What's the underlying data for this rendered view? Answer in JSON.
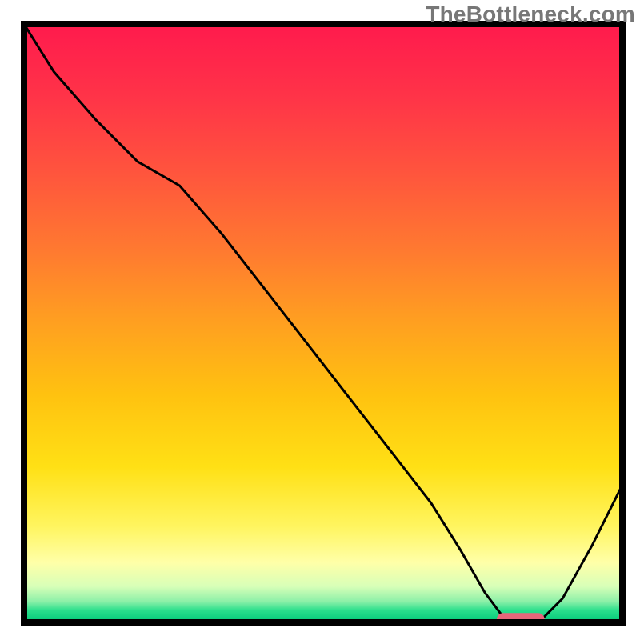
{
  "header": {
    "watermark": "TheBottleneck.com"
  },
  "colors": {
    "curve": "#000000",
    "marker": "#e6667a",
    "frame": "#000000",
    "gradient_stops": [
      "#ff1a4d",
      "#ff3348",
      "#ff553d",
      "#ff7a30",
      "#ffa020",
      "#ffc210",
      "#ffe015",
      "#fff560",
      "#ffffa8",
      "#d8ffb8",
      "#8cf0a8",
      "#2adf8c",
      "#00c878"
    ]
  },
  "chart_data": {
    "type": "line",
    "title": "",
    "xlabel": "",
    "ylabel": "",
    "xlim": [
      0,
      100
    ],
    "ylim": [
      0,
      100
    ],
    "grid": false,
    "legend": false,
    "x": [
      0,
      5,
      12,
      19,
      26,
      33,
      40,
      47,
      54,
      61,
      68,
      73,
      77,
      80,
      83,
      86,
      90,
      95,
      100
    ],
    "values": [
      100,
      92,
      84,
      77,
      73,
      65,
      56,
      47,
      38,
      29,
      20,
      12,
      5,
      1,
      0,
      0,
      4,
      13,
      23
    ],
    "trough_marker": {
      "x_start": 79,
      "x_end": 87,
      "y": 0.5
    },
    "note": "axes have no visible tick labels; values are read/estimated in 0-100 normalized space from the rendered curve"
  }
}
